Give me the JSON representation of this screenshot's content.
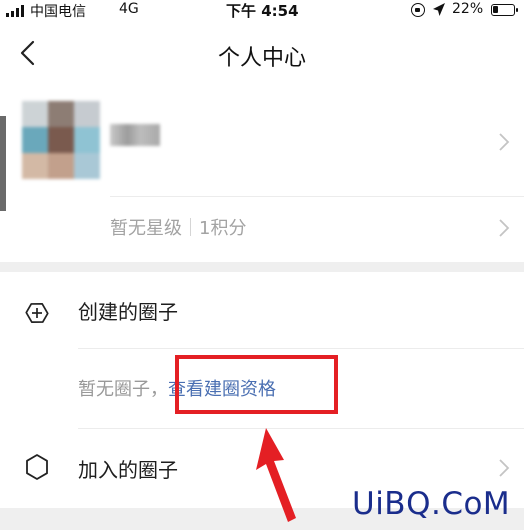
{
  "status_bar": {
    "carrier": "中国电信",
    "network": "4G",
    "time": "下午 4:54",
    "battery_percent": "22%"
  },
  "nav": {
    "title": "个人中心"
  },
  "profile": {
    "level": "暂无星级",
    "points": "1积分"
  },
  "created_circles": {
    "label": "创建的圈子",
    "empty_text": "暂无圈子，",
    "qualification_link": "查看建圈资格"
  },
  "joined_circles": {
    "label": "加入的圈子"
  },
  "watermark": "UiBQ.CoM",
  "colors": {
    "highlight": "#e41f24",
    "link": "#4a6fb2"
  },
  "icons": [
    "signal-icon",
    "rotation-lock-icon",
    "location-icon",
    "battery-icon",
    "back-icon",
    "chevron-right-icon",
    "plus-circle-icon",
    "hexagon-icon",
    "arrow-icon"
  ]
}
